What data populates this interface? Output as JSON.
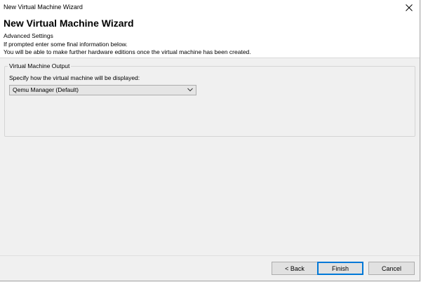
{
  "window": {
    "title": "New Virtual Machine Wizard"
  },
  "header": {
    "title": "New Virtual Machine Wizard",
    "subtitle": "Advanced Settings",
    "line1": "If prompted enter some final information below.",
    "line2": "You will be able to make further hardware editions once the virtual machine has been created."
  },
  "group": {
    "legend": "Virtual Machine Output",
    "label": "Specify how the virtual machine will be displayed:",
    "selected": "Qemu Manager (Default)"
  },
  "buttons": {
    "back": "< Back",
    "finish": "Finish",
    "cancel": "Cancel"
  },
  "icons": {
    "close": "close-icon",
    "dropdown": "chevron-down-icon"
  },
  "colors": {
    "accent": "#0078d7",
    "dialog_bg": "#f0f0f0",
    "header_bg": "#ffffff"
  }
}
